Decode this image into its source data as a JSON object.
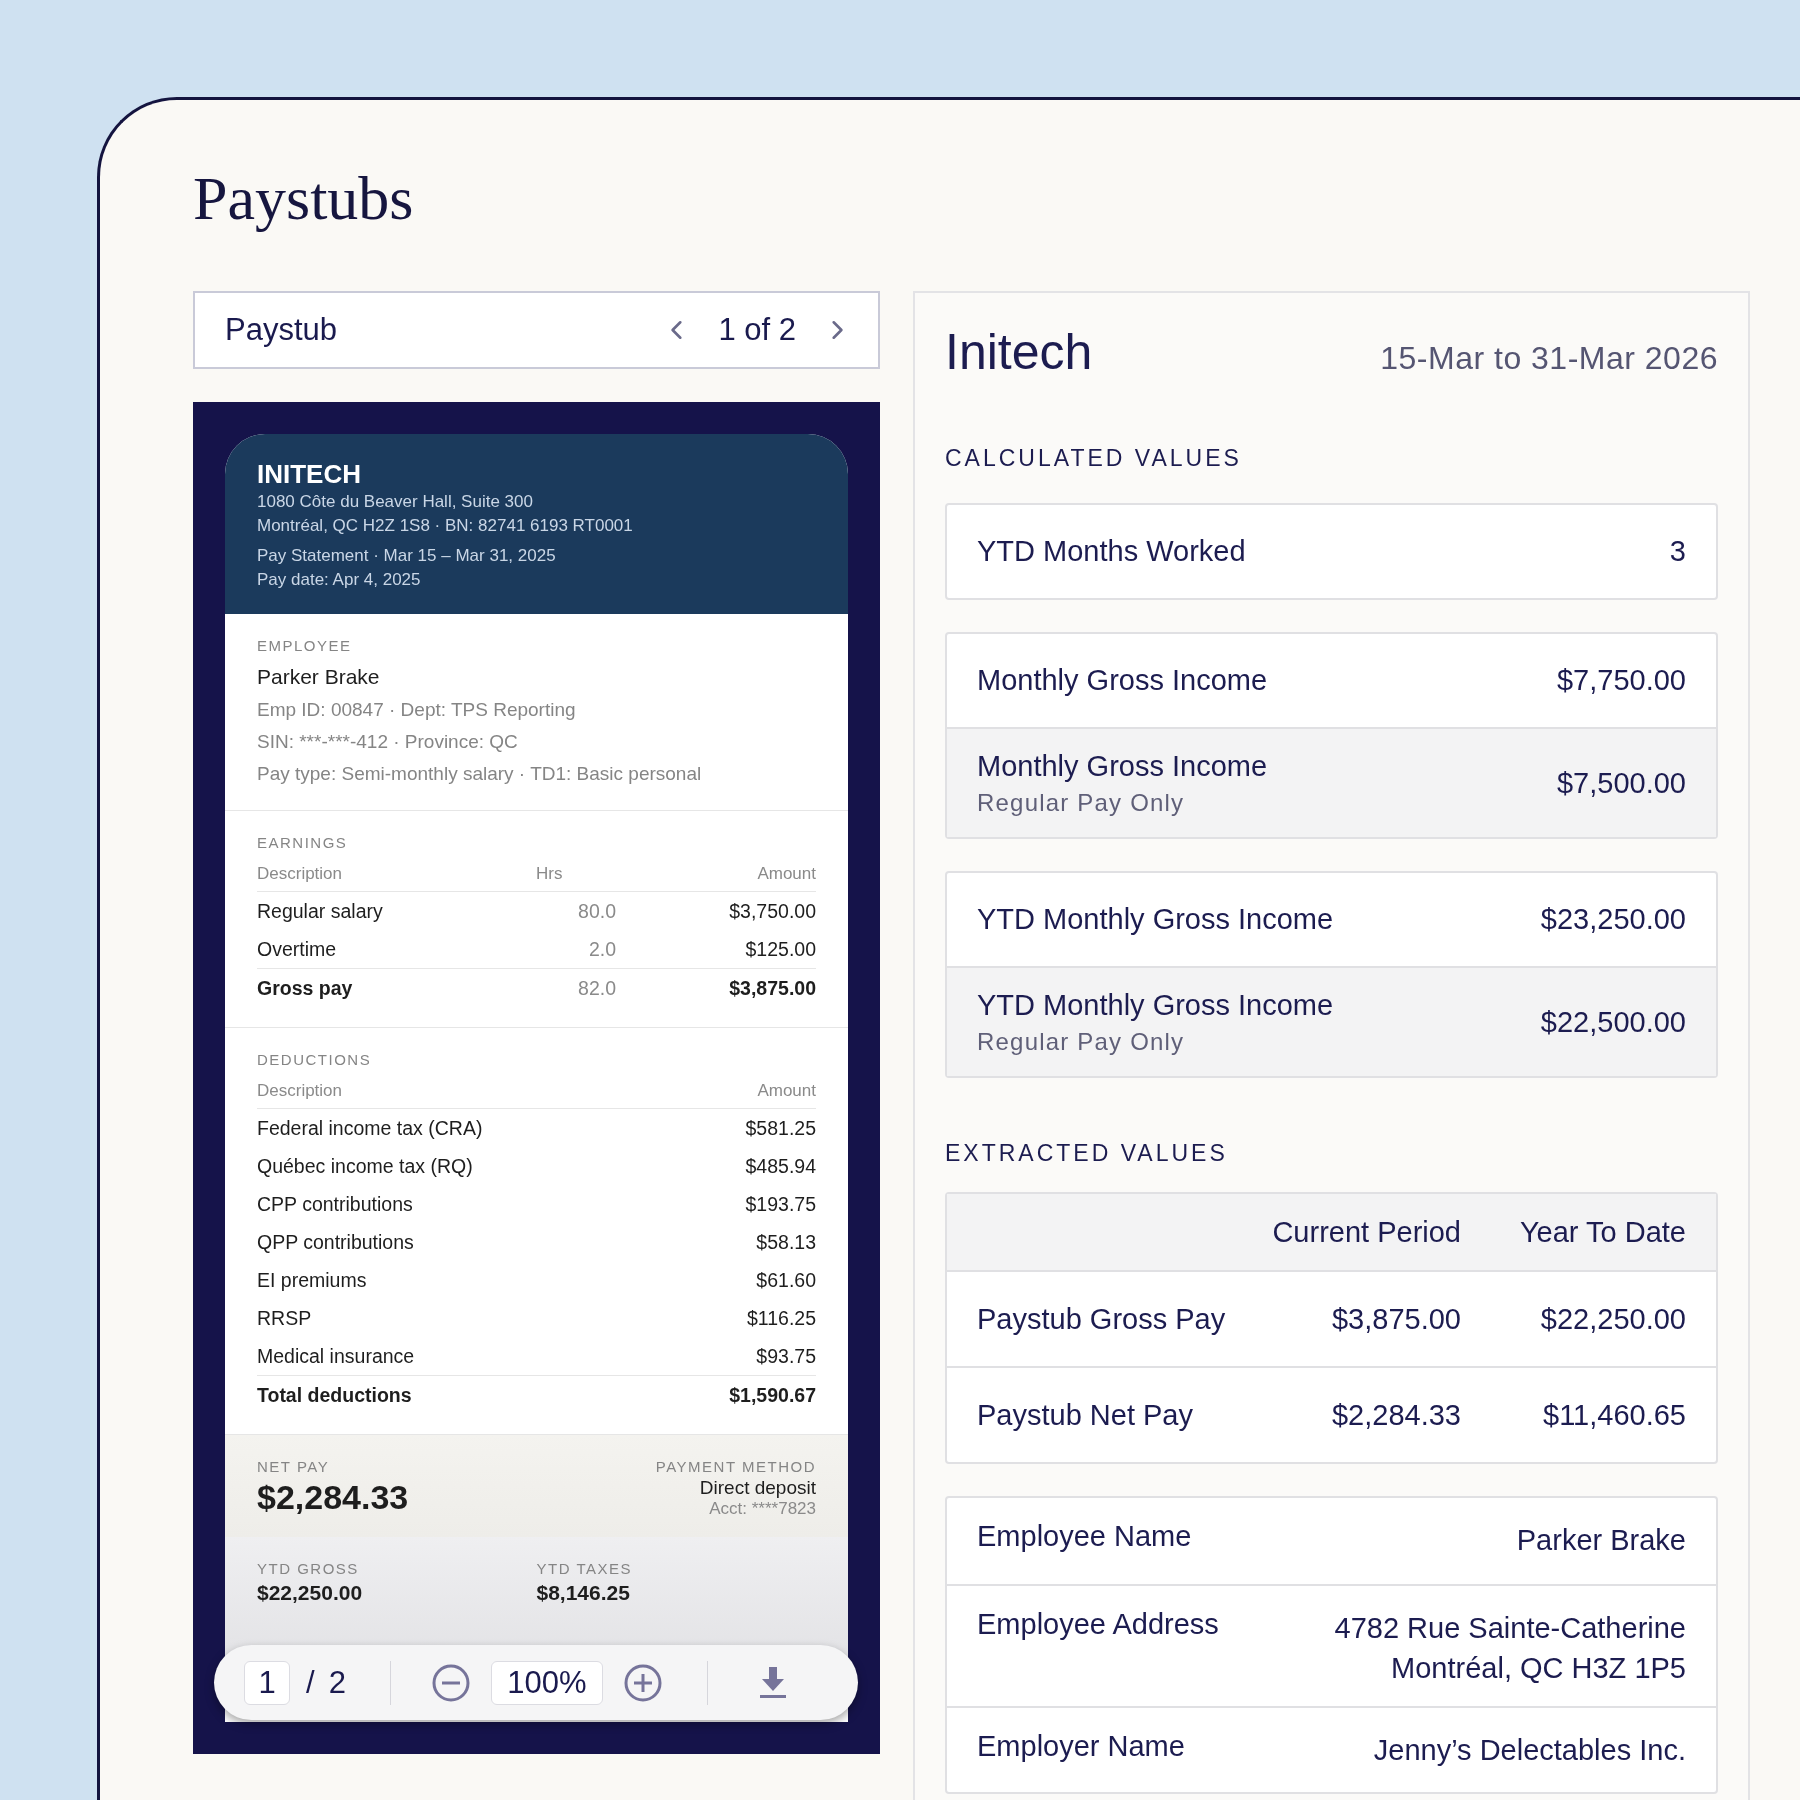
{
  "page": {
    "title": "Paystubs"
  },
  "pager": {
    "label": "Paystub",
    "position": "1 of 2"
  },
  "document": {
    "company": "INITECH",
    "address_lines": [
      "1080 Côte du Beaver Hall, Suite 300",
      "Montréal, QC H2Z 1S8 · BN: 82741 6193 RT0001"
    ],
    "statement_lines": [
      "Pay Statement · Mar 15 – Mar 31, 2025",
      "Pay date: Apr 4, 2025"
    ],
    "employee": {
      "heading": "EMPLOYEE",
      "name": "Parker Brake",
      "details": [
        "Emp ID: 00847 · Dept: TPS Reporting",
        "SIN: ***-***-412 · Province: QC",
        "Pay type: Semi-monthly salary · TD1: Basic personal"
      ]
    },
    "earnings": {
      "heading": "EARNINGS",
      "columns": [
        "Description",
        "Hrs",
        "Amount"
      ],
      "rows": [
        {
          "description": "Regular salary",
          "hours": "80.0",
          "amount": "$3,750.00",
          "total": false
        },
        {
          "description": "Overtime",
          "hours": "2.0",
          "amount": "$125.00",
          "total": false
        },
        {
          "description": "Gross pay",
          "hours": "82.0",
          "amount": "$3,875.00",
          "total": true
        }
      ]
    },
    "deductions": {
      "heading": "DEDUCTIONS",
      "columns": [
        "Description",
        "Amount"
      ],
      "rows": [
        {
          "description": "Federal income tax (CRA)",
          "amount": "$581.25",
          "total": false
        },
        {
          "description": "Québec income tax (RQ)",
          "amount": "$485.94",
          "total": false
        },
        {
          "description": "CPP contributions",
          "amount": "$193.75",
          "total": false
        },
        {
          "description": "QPP contributions",
          "amount": "$58.13",
          "total": false
        },
        {
          "description": "EI premiums",
          "amount": "$61.60",
          "total": false
        },
        {
          "description": "RRSP",
          "amount": "$116.25",
          "total": false
        },
        {
          "description": "Medical insurance",
          "amount": "$93.75",
          "total": false
        },
        {
          "description": "Total deductions",
          "amount": "$1,590.67",
          "total": true
        }
      ]
    },
    "net_pay": {
      "label": "NET PAY",
      "amount": "$2,284.33",
      "method_label": "PAYMENT METHOD",
      "method": "Direct deposit",
      "account": "Acct: ****7823"
    },
    "ytd": [
      {
        "label": "YTD GROSS",
        "value": "$22,250.00"
      },
      {
        "label": "YTD TAXES",
        "value": "$8,146.25"
      }
    ]
  },
  "viewer_toolbar": {
    "page": "1",
    "separator": "/",
    "page_count": "2",
    "zoom": "100%"
  },
  "summary": {
    "company": "Initech",
    "period": "15-Mar to 31-Mar 2026",
    "calculated": {
      "heading": "CALCULATED VALUES",
      "groups": [
        [
          {
            "label": "YTD Months Worked",
            "value": "3"
          }
        ],
        [
          {
            "label": "Monthly Gross Income",
            "value": "$7,750.00"
          },
          {
            "label": "Monthly Gross Income",
            "sublabel": "Regular Pay Only",
            "value": "$7,500.00"
          }
        ],
        [
          {
            "label": "YTD Monthly Gross Income",
            "value": "$23,250.00"
          },
          {
            "label": "YTD Monthly Gross Income",
            "sublabel": "Regular Pay Only",
            "value": "$22,500.00"
          }
        ]
      ]
    },
    "extracted": {
      "heading": "EXTRACTED VALUES",
      "columns": [
        "Current Period",
        "Year To Date"
      ],
      "rows": [
        {
          "label": "Paystub Gross Pay",
          "current": "$3,875.00",
          "ytd": "$22,250.00"
        },
        {
          "label": "Paystub Net Pay",
          "current": "$2,284.33",
          "ytd": "$11,460.65"
        }
      ]
    },
    "details": [
      {
        "label": "Employee Name",
        "value_lines": [
          "Parker Brake"
        ]
      },
      {
        "label": "Employee Address",
        "value_lines": [
          "4782 Rue Sainte-Catherine",
          "Montréal, QC H3Z 1P5"
        ]
      },
      {
        "label": "Employer Name",
        "value_lines": [
          "Jenny’s Delectables Inc."
        ]
      }
    ]
  }
}
